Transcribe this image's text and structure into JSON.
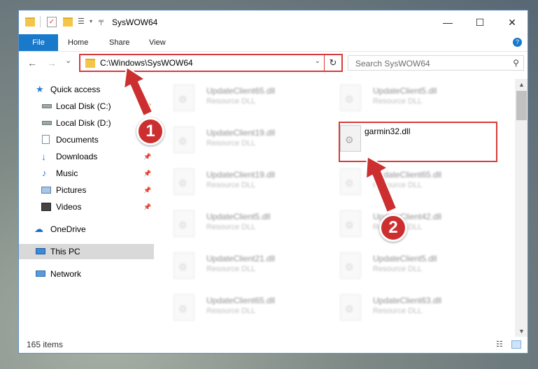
{
  "window": {
    "title": "SysWOW64",
    "controls": {
      "minimize": "—",
      "maximize": "☐",
      "close": "✕"
    }
  },
  "ribbon": {
    "tabs": [
      "File",
      "Home",
      "Share",
      "View"
    ],
    "expand_glyph": "?"
  },
  "navigation": {
    "back": "←",
    "forward": "→",
    "recent": "⌄",
    "up": "↑",
    "address_path": "C:\\Windows\\SysWOW64",
    "search_placeholder": "Search SysWOW64"
  },
  "sidebar": {
    "items": [
      {
        "label": "Quick access",
        "icon": "star-icon"
      },
      {
        "label": "Local Disk (C:)",
        "icon": "drive-icon"
      },
      {
        "label": "Local Disk (D:)",
        "icon": "drive-icon"
      },
      {
        "label": "Documents",
        "icon": "documents-icon"
      },
      {
        "label": "Downloads",
        "icon": "downloads-icon"
      },
      {
        "label": "Music",
        "icon": "music-icon"
      },
      {
        "label": "Pictures",
        "icon": "pictures-icon"
      },
      {
        "label": "Videos",
        "icon": "videos-icon"
      },
      {
        "label": "OneDrive",
        "icon": "cloud-icon"
      },
      {
        "label": "This PC",
        "icon": "computer-icon"
      },
      {
        "label": "Network",
        "icon": "network-icon"
      }
    ]
  },
  "files": {
    "left_column": [
      {
        "name": "UpdateClient65.dll",
        "type": "Resource DLL"
      },
      {
        "name": "UpdateClient19.dll",
        "type": "Resource DLL"
      },
      {
        "name": "UpdateClient19.dll",
        "type": "Resource DLL"
      },
      {
        "name": "UpdateClient5.dll",
        "type": "Resource DLL"
      },
      {
        "name": "UpdateClient21.dll",
        "type": "Resource DLL"
      },
      {
        "name": "UpdateClient65.dll",
        "type": "Resource DLL"
      }
    ],
    "right_column": [
      {
        "name": "UpdateClient5.dll",
        "type": "Resource DLL"
      },
      {
        "name": "garmin32.dll",
        "type": ""
      },
      {
        "name": "UpdateClient65.dll",
        "type": "Resource DLL"
      },
      {
        "name": "UpdateClient42.dll",
        "type": "Resource DLL"
      },
      {
        "name": "UpdateClient5.dll",
        "type": "Resource DLL"
      },
      {
        "name": "UpdateClient63.dll",
        "type": "Resource DLL"
      }
    ]
  },
  "status": {
    "item_count": "165 items"
  },
  "callouts": {
    "step1": "1",
    "step2": "2"
  },
  "colors": {
    "accent": "#1979ca",
    "highlight": "#d93a3a",
    "callout": "#cc2f2f"
  }
}
